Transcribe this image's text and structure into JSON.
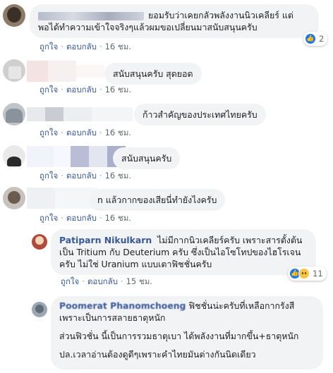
{
  "comments": [
    {
      "text": "ยอมรับว่าเคยกลัวพลังงานนิวเคลียร์ แต่พอได้ทำความเข้าใจจริงๆแล้วผมขอเปลี่ยนมาสนับสนุนครับ",
      "reaction_count": "2",
      "like_label": "ถูกใจ",
      "reply_label": "ตอบกลับ",
      "time": "16 ชม."
    },
    {
      "text": "สนับสนุนครับ สุดยอด",
      "like_label": "ถูกใจ",
      "reply_label": "ตอบกลับ",
      "time": "16 ชม."
    },
    {
      "text": "ก้าวสำคัญของประเทศไทยครับ",
      "like_label": "ถูกใจ",
      "reply_label": "ตอบกลับ",
      "time": "16 ชม."
    },
    {
      "text": "สนับสนุนครับ",
      "like_label": "ถูกใจ",
      "reply_label": "ตอบกลับ",
      "time": "16 ชม."
    },
    {
      "text": "n แล้วกากของเสียนี่ทำยังไงครับ",
      "like_label": "ถูกใจ",
      "reply_label": "ตอบกลับ",
      "time": "16 ชม."
    }
  ],
  "replies": [
    {
      "author": "Patiparn Nikulkarn",
      "text": "ไม่มีกากนิวเคลียร์ครับ เพราะสารตั้งต้นเป็น Tritium กับ Deuterium ครับ ซึ่งเป็นไอโซโทปของไฮโรเจนครับ ไม่ใช่ Uranium แบบเตาฟิชชั่นครับ",
      "reaction_count": "11",
      "like_label": "ถูกใจ",
      "reply_label": "ตอบกลับ",
      "time": "15 ชม."
    },
    {
      "author": "Poomerat Phanomchoeng",
      "paragraphs": [
        "ฟิชชั่นน่ะครับที่เหลือกากรังสีเพราะเป็นการสลายธาตุหนัก",
        "ส่วนฟิวชั่น นี้เป็นการรวมธาตุเบา ได้พลังงานที่มากขึ้น+ธาตุหนัก",
        "ปล.เวลาอ่านต้องดูดีๆเพราะคำไทยมันต่างกันนิดเดียว"
      ]
    }
  ],
  "icons": {
    "like": "like-icon",
    "sad": "sad-reaction-icon"
  },
  "colors": {
    "bubble": "#f2f3f5",
    "link": "#385898",
    "like_blue": "#1877f2"
  }
}
